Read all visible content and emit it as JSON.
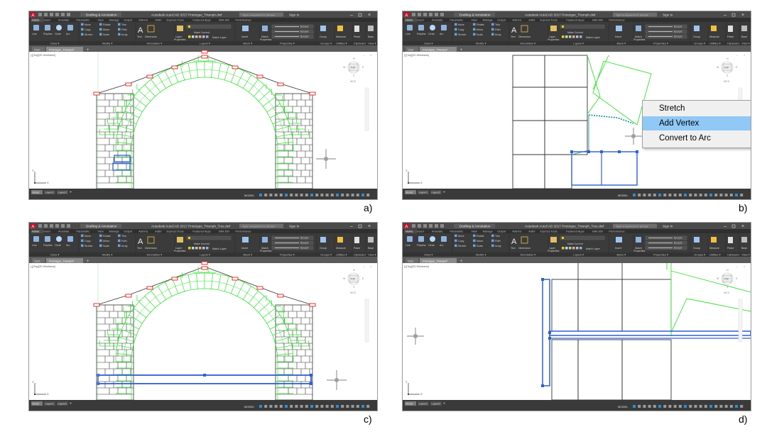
{
  "app": {
    "logo_letter": "A",
    "window_titles": [
      "Autodesk AutoCAD 2017  Prototype_Triumph.dwf",
      "Autodesk AutoCAD 2017  Prototype_Triumph.dwf",
      "Autodesk AutoCAD 2017  Prototype_Triumph_Tree.dwf",
      "Autodesk AutoCAD 2017  Prototype_Triumph_Tree.dwf"
    ],
    "workspace": "Drafting & Annotation",
    "search_placeholder": "Type a keyword or phrase",
    "sign_in": "Sign In",
    "ribbon_tabs": [
      "Home",
      "Insert",
      "Annotate",
      "Parametric",
      "View",
      "Manage",
      "Output",
      "Add-ins",
      "A360",
      "Express Tools",
      "Featured Apps",
      "BIM 360",
      "Performance"
    ],
    "ribbon_groups": [
      "Draw",
      "Modify",
      "Annotation",
      "Layers",
      "Block",
      "Properties",
      "Groups",
      "Utilities",
      "Clipboard",
      "View"
    ],
    "draw_tools": [
      "Line",
      "Polyline",
      "Circle",
      "Arc"
    ],
    "modify_tools": [
      "Move",
      "Rotate",
      "Trim",
      "Copy",
      "Mirror",
      "Fillet",
      "Stretch",
      "Scale",
      "Array"
    ],
    "annotation_tools": [
      "Text",
      "Dimension"
    ],
    "layer_tools": [
      "Layer Properties",
      "Make Current",
      "Match Layer"
    ],
    "block_tools": [
      "Insert"
    ],
    "properties_tools": [
      "Match Properties",
      "ByLayer"
    ],
    "groups_tools": [
      "Group"
    ],
    "utilities_tools": [
      "Measure"
    ],
    "clipboard_tools": [
      "Paste"
    ],
    "view_tools": [
      "Base"
    ],
    "file_tabs": [
      "Start",
      "Prototype_Triumph*"
    ],
    "viewport_label": "[-][Top][2D Wireframe]",
    "viewcube": {
      "n": "N",
      "face": "TOP",
      "s": "S",
      "w": "W",
      "e": "E",
      "wcs": "WCS"
    },
    "layout_tabs": [
      "Model",
      "Layout1",
      "Layout2"
    ],
    "status_model": "MODEL",
    "ucs": {
      "x": "X",
      "y": "Y"
    }
  },
  "panels": [
    {
      "id": "a",
      "label": "a)"
    },
    {
      "id": "b",
      "label": "b)"
    },
    {
      "id": "c",
      "label": "c)"
    },
    {
      "id": "d",
      "label": "d)"
    }
  ],
  "context_menu": {
    "items": [
      "Stretch",
      "Add Vertex",
      "Convert to Arc"
    ],
    "highlighted_index": 1
  },
  "colors": {
    "title_bar": "#4b4b4b",
    "ribbon_bg": "#3b3b3b",
    "ribbon_tabs_bg": "#2f2f2f",
    "file_tab_bar": "#5a5a5a",
    "model_space": "#ffffff",
    "status_bar": "#3a3a3a",
    "brick_black": "#333333",
    "brick_green": "#30e030",
    "grip_red": "#e02020",
    "selection_blue": "#2f5fd0",
    "accent_blue": "#2b8fd6",
    "menu_highlight": "#90c8f6"
  }
}
